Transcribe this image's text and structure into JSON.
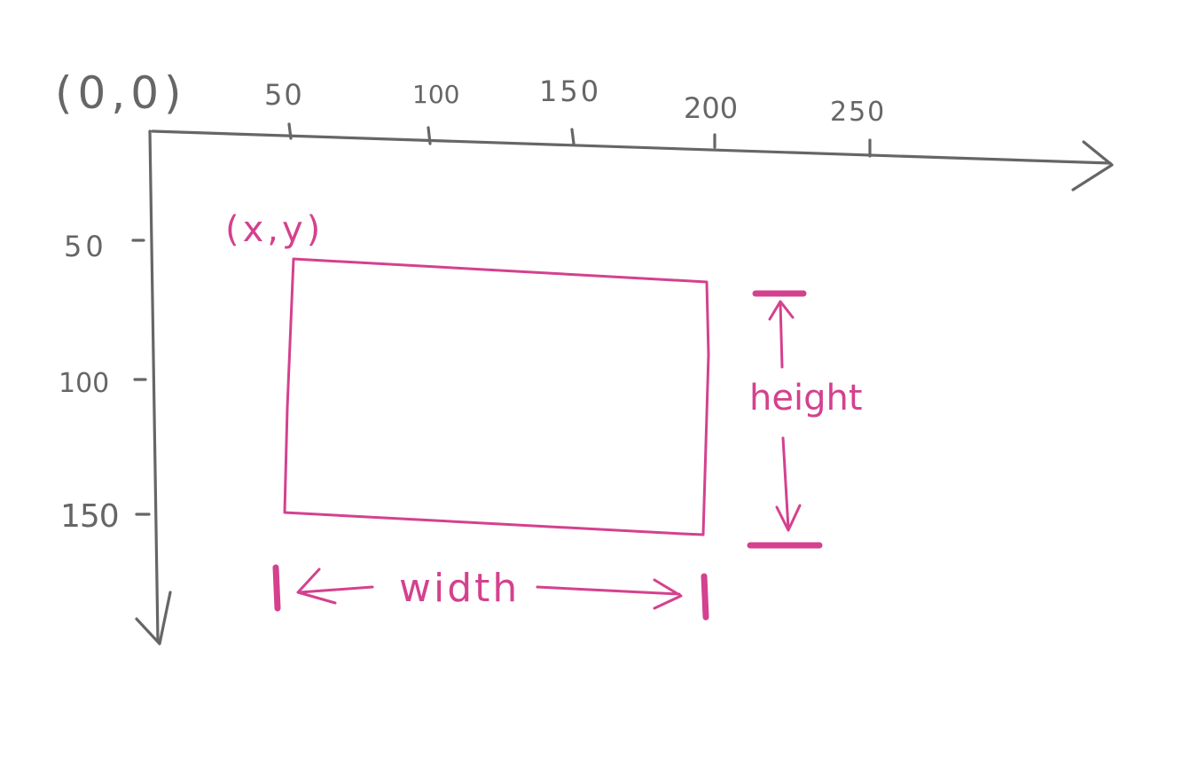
{
  "origin_label": "(0,0)",
  "x_ticks": [
    "50",
    "100",
    "150",
    "200",
    "250"
  ],
  "y_ticks": [
    "50",
    "100",
    "150"
  ],
  "point_label": "(x,y)",
  "width_label": "width",
  "height_label": "height",
  "colors": {
    "axis": "#666666",
    "annotation": "#d4418e"
  }
}
